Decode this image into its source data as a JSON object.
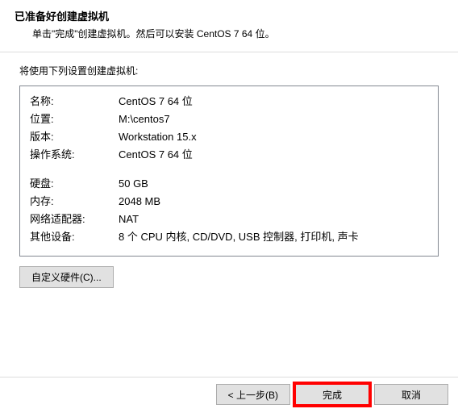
{
  "header": {
    "title": "已准备好创建虚拟机",
    "subtitle": "单击\"完成\"创建虚拟机。然后可以安装 CentOS 7 64 位。"
  },
  "intro": "将使用下列设置创建虚拟机:",
  "summary": {
    "name_label": "名称:",
    "name_value": "CentOS 7 64 位",
    "location_label": "位置:",
    "location_value": "M:\\centos7",
    "version_label": "版本:",
    "version_value": "Workstation 15.x",
    "os_label": "操作系统:",
    "os_value": "CentOS 7 64 位",
    "disk_label": "硬盘:",
    "disk_value": "50 GB",
    "memory_label": "内存:",
    "memory_value": "2048 MB",
    "net_label": "网络适配器:",
    "net_value": "NAT",
    "other_label": "其他设备:",
    "other_value": "8 个 CPU 内核, CD/DVD, USB 控制器, 打印机, 声卡"
  },
  "buttons": {
    "customize": "自定义硬件(C)...",
    "back": "< 上一步(B)",
    "finish": "完成",
    "cancel": "取消"
  }
}
